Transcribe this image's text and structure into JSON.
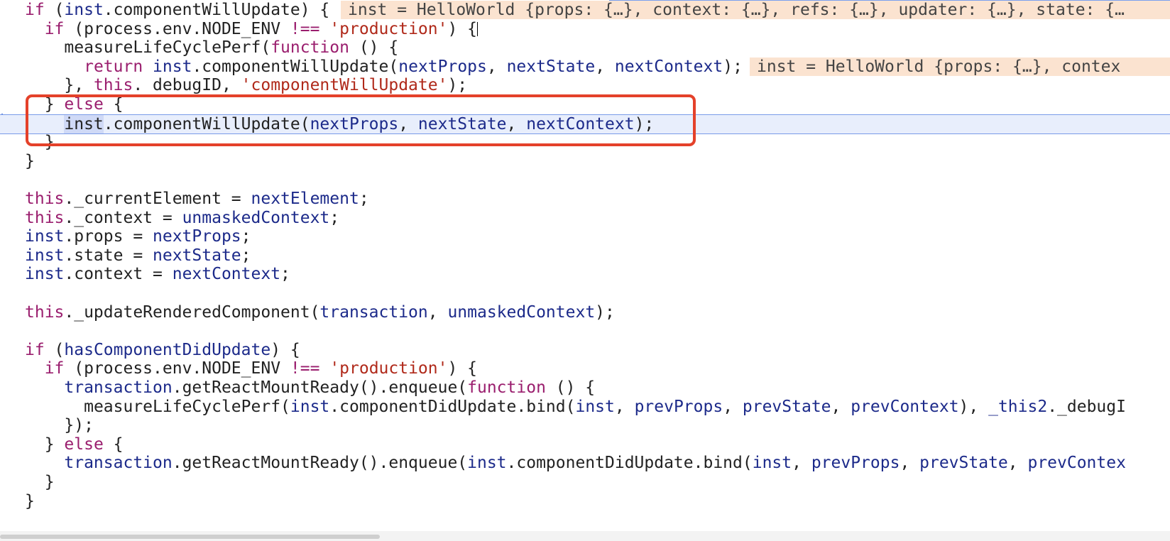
{
  "editor": {
    "lines": [
      {
        "indent": "",
        "tokens": [
          [
            "kw",
            "if"
          ],
          [
            "plain",
            " ("
          ],
          [
            "id",
            "inst"
          ],
          [
            "plain",
            ".componentWillUpdate) {"
          ]
        ],
        "hint": "inst = HelloWorld {props: {…}, context: {…}, refs: {…}, updater: {…}, state: {…"
      },
      {
        "indent": "  ",
        "tokens": [
          [
            "kw",
            "if"
          ],
          [
            "plain",
            " (process.env.NODE_ENV "
          ],
          [
            "kw",
            "!=="
          ],
          [
            "plain",
            " "
          ],
          [
            "str",
            "'production'"
          ],
          [
            "plain",
            ") {"
          ]
        ],
        "caret": true
      },
      {
        "indent": "    ",
        "tokens": [
          [
            "plain",
            "measureLifeCyclePerf("
          ],
          [
            "kw",
            "function"
          ],
          [
            "plain",
            " () {"
          ]
        ]
      },
      {
        "indent": "      ",
        "tokens": [
          [
            "kw",
            "return"
          ],
          [
            "plain",
            " "
          ],
          [
            "id",
            "inst"
          ],
          [
            "plain",
            ".componentWillUpdate("
          ],
          [
            "id",
            "nextProps"
          ],
          [
            "plain",
            ", "
          ],
          [
            "id",
            "nextState"
          ],
          [
            "plain",
            ", "
          ],
          [
            "id",
            "nextContext"
          ],
          [
            "plain",
            ");"
          ]
        ],
        "hint": "inst = HelloWorld {props: {…}, contex"
      },
      {
        "indent": "    ",
        "tokens": [
          [
            "plain",
            "}, "
          ],
          [
            "kw",
            "this"
          ],
          [
            "plain",
            ". debugID, "
          ],
          [
            "str",
            "'componentWillUpdate'"
          ],
          [
            "plain",
            ");"
          ]
        ]
      },
      {
        "indent": "  ",
        "tokens": [
          [
            "plain",
            "} "
          ],
          [
            "kw",
            "else"
          ],
          [
            "plain",
            " {"
          ]
        ]
      },
      {
        "indent": "    ",
        "tokens": [
          [
            "sel",
            "inst"
          ],
          [
            "plain",
            ".componentWillUpdate("
          ],
          [
            "id",
            "nextProps"
          ],
          [
            "plain",
            ", "
          ],
          [
            "id",
            "nextState"
          ],
          [
            "plain",
            ", "
          ],
          [
            "id",
            "nextContext"
          ],
          [
            "plain",
            ");"
          ]
        ],
        "current": true
      },
      {
        "indent": "  ",
        "tokens": [
          [
            "plain",
            "}"
          ]
        ]
      },
      {
        "indent": "",
        "tokens": [
          [
            "plain",
            "}"
          ]
        ]
      },
      {
        "indent": "",
        "tokens": []
      },
      {
        "indent": "",
        "tokens": [
          [
            "kw",
            "this"
          ],
          [
            "plain",
            "._currentElement = "
          ],
          [
            "id",
            "nextElement"
          ],
          [
            "plain",
            ";"
          ]
        ]
      },
      {
        "indent": "",
        "tokens": [
          [
            "kw",
            "this"
          ],
          [
            "plain",
            "._context = "
          ],
          [
            "id",
            "unmaskedContext"
          ],
          [
            "plain",
            ";"
          ]
        ]
      },
      {
        "indent": "",
        "tokens": [
          [
            "id",
            "inst"
          ],
          [
            "plain",
            ".props = "
          ],
          [
            "id",
            "nextProps"
          ],
          [
            "plain",
            ";"
          ]
        ]
      },
      {
        "indent": "",
        "tokens": [
          [
            "id",
            "inst"
          ],
          [
            "plain",
            ".state = "
          ],
          [
            "id",
            "nextState"
          ],
          [
            "plain",
            ";"
          ]
        ]
      },
      {
        "indent": "",
        "tokens": [
          [
            "id",
            "inst"
          ],
          [
            "plain",
            ".context = "
          ],
          [
            "id",
            "nextContext"
          ],
          [
            "plain",
            ";"
          ]
        ]
      },
      {
        "indent": "",
        "tokens": []
      },
      {
        "indent": "",
        "tokens": [
          [
            "kw",
            "this"
          ],
          [
            "plain",
            "._updateRenderedComponent("
          ],
          [
            "id",
            "transaction"
          ],
          [
            "plain",
            ", "
          ],
          [
            "id",
            "unmaskedContext"
          ],
          [
            "plain",
            ");"
          ]
        ]
      },
      {
        "indent": "",
        "tokens": []
      },
      {
        "indent": "",
        "tokens": [
          [
            "kw",
            "if"
          ],
          [
            "plain",
            " ("
          ],
          [
            "id",
            "hasComponentDidUpdate"
          ],
          [
            "plain",
            ") {"
          ]
        ]
      },
      {
        "indent": "  ",
        "tokens": [
          [
            "kw",
            "if"
          ],
          [
            "plain",
            " (process.env.NODE_ENV "
          ],
          [
            "kw",
            "!=="
          ],
          [
            "plain",
            " "
          ],
          [
            "str",
            "'production'"
          ],
          [
            "plain",
            ") {"
          ]
        ]
      },
      {
        "indent": "    ",
        "tokens": [
          [
            "id",
            "transaction"
          ],
          [
            "plain",
            ".getReactMountReady().enqueue("
          ],
          [
            "kw",
            "function"
          ],
          [
            "plain",
            " () {"
          ]
        ]
      },
      {
        "indent": "      ",
        "tokens": [
          [
            "plain",
            "measureLifeCyclePerf("
          ],
          [
            "id",
            "inst"
          ],
          [
            "plain",
            ".componentDidUpdate.bind("
          ],
          [
            "id",
            "inst"
          ],
          [
            "plain",
            ", "
          ],
          [
            "id",
            "prevProps"
          ],
          [
            "plain",
            ", "
          ],
          [
            "id",
            "prevState"
          ],
          [
            "plain",
            ", "
          ],
          [
            "id",
            "prevContext"
          ],
          [
            "plain",
            "), "
          ],
          [
            "id",
            "_this2"
          ],
          [
            "plain",
            "._debugI"
          ]
        ]
      },
      {
        "indent": "    ",
        "tokens": [
          [
            "plain",
            "});"
          ]
        ]
      },
      {
        "indent": "  ",
        "tokens": [
          [
            "plain",
            "} "
          ],
          [
            "kw",
            "else"
          ],
          [
            "plain",
            " {"
          ]
        ]
      },
      {
        "indent": "    ",
        "tokens": [
          [
            "id",
            "transaction"
          ],
          [
            "plain",
            ".getReactMountReady().enqueue("
          ],
          [
            "id",
            "inst"
          ],
          [
            "plain",
            ".componentDidUpdate.bind("
          ],
          [
            "id",
            "inst"
          ],
          [
            "plain",
            ", "
          ],
          [
            "id",
            "prevProps"
          ],
          [
            "plain",
            ", "
          ],
          [
            "id",
            "prevState"
          ],
          [
            "plain",
            ", "
          ],
          [
            "id",
            "prevContex"
          ]
        ]
      },
      {
        "indent": "  ",
        "tokens": [
          [
            "plain",
            "}"
          ]
        ]
      },
      {
        "indent": "",
        "tokens": [
          [
            "plain",
            "}"
          ]
        ]
      }
    ]
  },
  "colors": {
    "keyword": "#9a1e6e",
    "identifier": "#1c2a8a",
    "string": "#b0291a",
    "highlight_box": "#e4412a",
    "hint_bg": "#fbe3d0",
    "current_line_bg": "#e8eefc"
  }
}
